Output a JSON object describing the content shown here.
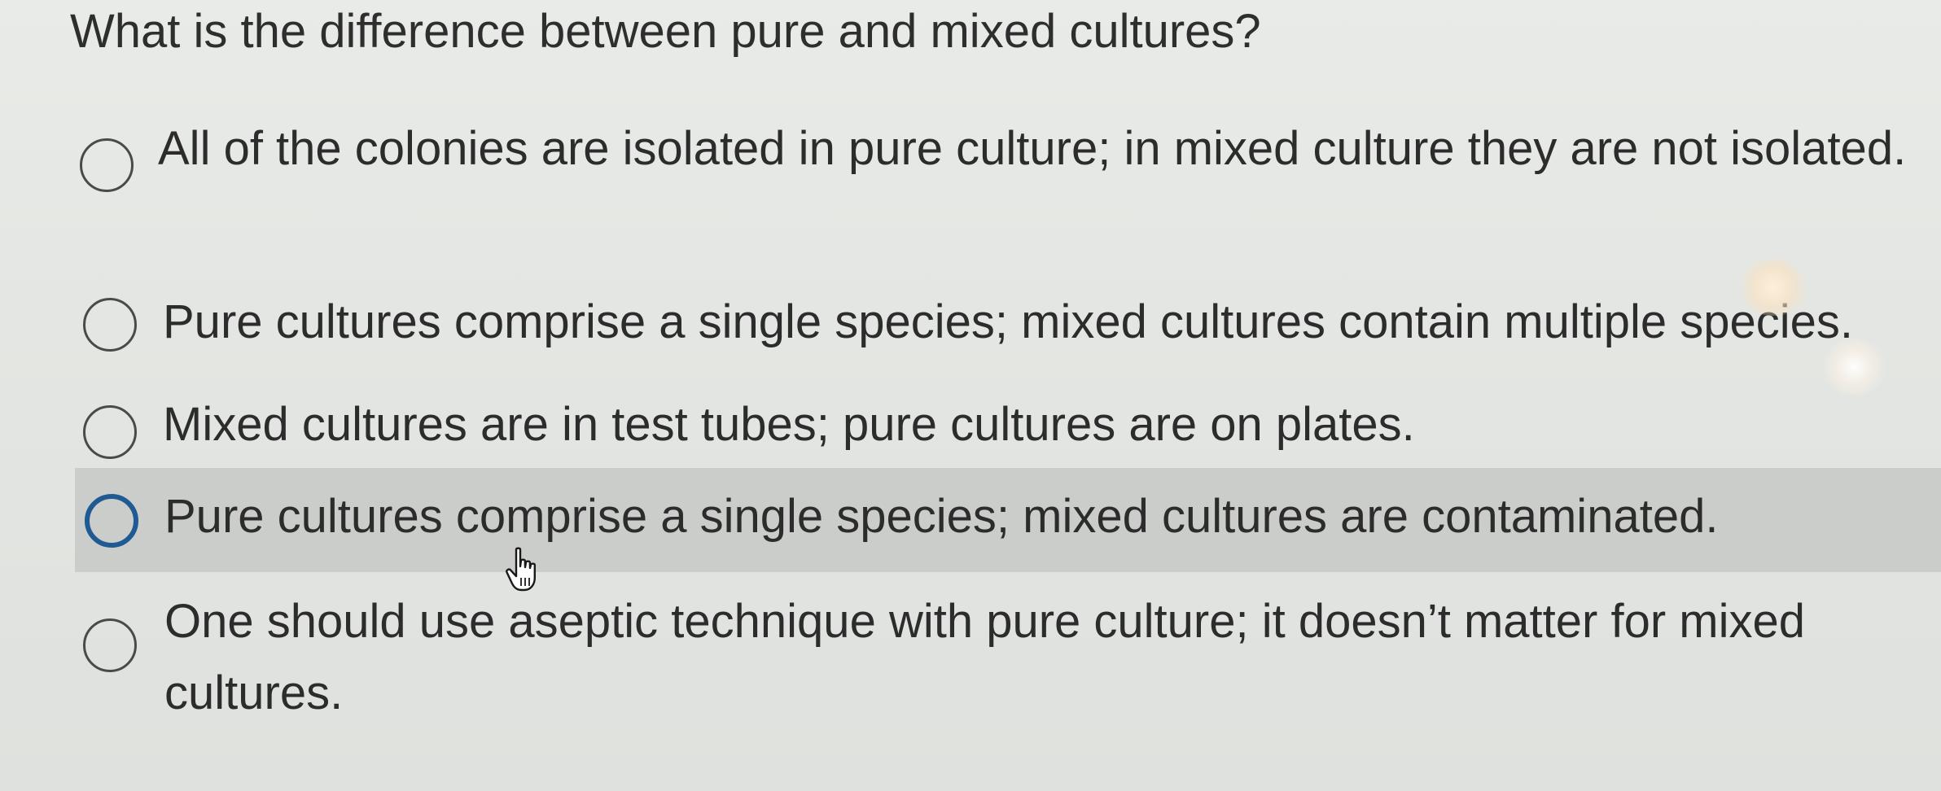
{
  "question": {
    "text": "What is the difference between pure and mixed cultures?"
  },
  "options": [
    {
      "label": "All of the colonies are isolated in pure culture; in mixed culture they are not isolated.",
      "selected": false,
      "hovered": false
    },
    {
      "label": "Pure cultures comprise a single species; mixed cultures contain multiple species.",
      "selected": false,
      "hovered": false
    },
    {
      "label": "Mixed cultures are in test tubes; pure cultures are on plates.",
      "selected": false,
      "hovered": false
    },
    {
      "label": "Pure cultures comprise a single species; mixed cultures are contaminated.",
      "selected": false,
      "hovered": true
    },
    {
      "label": "One should use aseptic technique with pure culture; it doesn’t matter for mixed cultures.",
      "selected": false,
      "hovered": false
    }
  ],
  "colors": {
    "background": "#e4e6e3",
    "hover_row": "#cbcdca",
    "radio_border": "#4a4a4a",
    "radio_focus_border": "#1f5a93",
    "text": "#2c2c2c"
  },
  "icons": {
    "radio": "radio-empty-icon",
    "cursor": "hand-pointer-icon"
  }
}
